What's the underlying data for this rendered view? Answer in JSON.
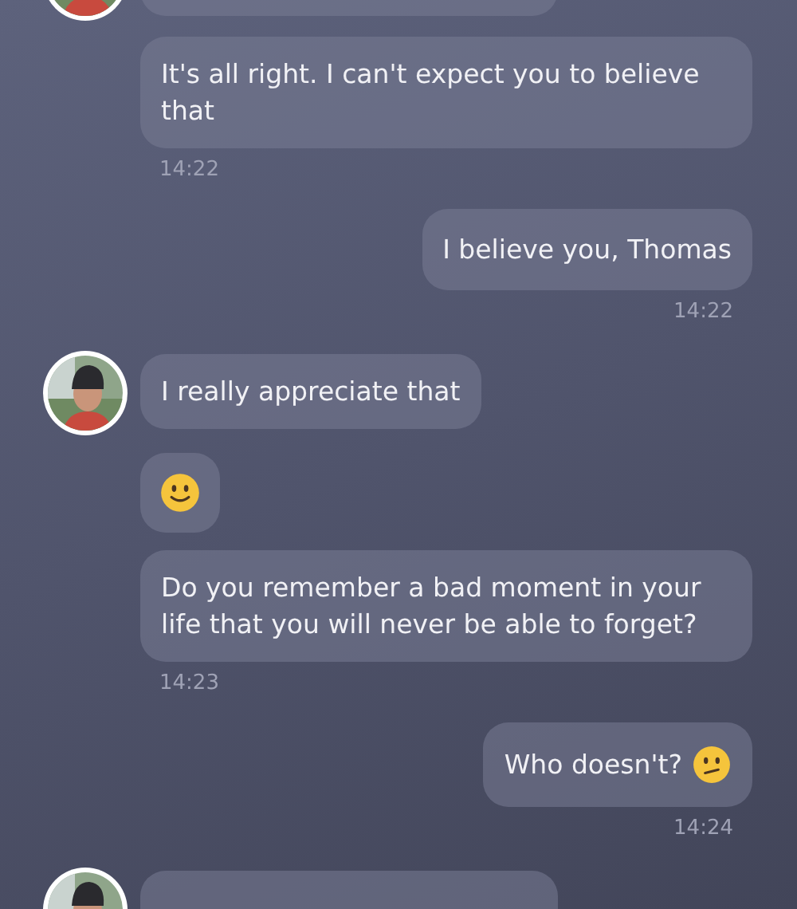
{
  "messages": [
    {
      "kind": "clipped",
      "outgoing": false,
      "avatar": true
    },
    {
      "kind": "text",
      "outgoing": false,
      "avatar": false,
      "text": "It's all right. I can't expect you to believe that",
      "time": "14:22"
    },
    {
      "kind": "text",
      "outgoing": true,
      "avatar": false,
      "text": "I believe you, Thomas",
      "time": "14:22"
    },
    {
      "kind": "text",
      "outgoing": false,
      "avatar": true,
      "text": "I really appreciate that"
    },
    {
      "kind": "emoji",
      "outgoing": false,
      "avatar": false
    },
    {
      "kind": "text",
      "outgoing": false,
      "avatar": false,
      "text": "Do you remember a bad moment in your life that you will never be able to forget?",
      "time": "14:23"
    },
    {
      "kind": "text",
      "outgoing": true,
      "avatar": false,
      "text": "Who doesn't?",
      "confused_emoji": true,
      "time": "14:24"
    },
    {
      "kind": "clipped",
      "outgoing": false,
      "avatar": true
    }
  ]
}
